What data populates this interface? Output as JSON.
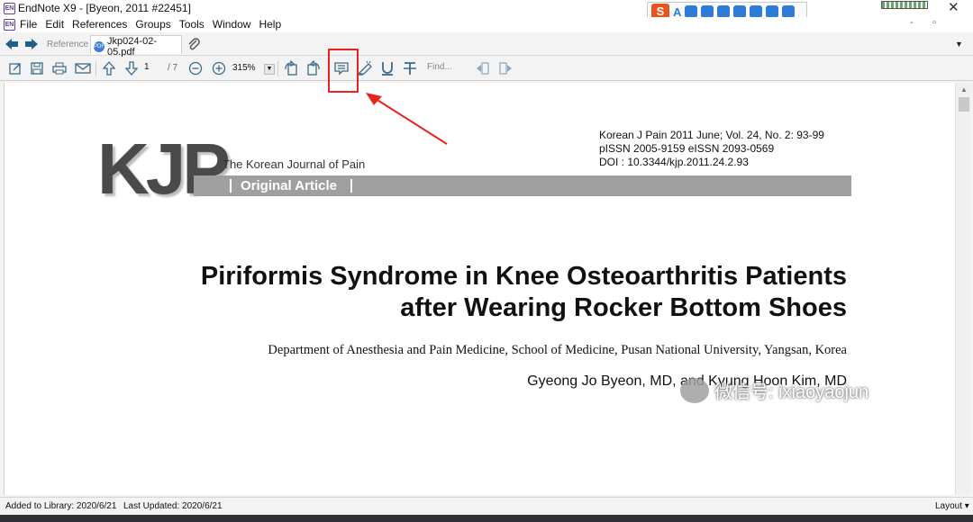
{
  "window": {
    "title": "EndNote X9 - [Byeon, 2011 #22451]",
    "app_icon": "EN",
    "close_glyph": "✕"
  },
  "ime": {
    "logo": "S",
    "label": "A"
  },
  "menu": {
    "items": [
      "File",
      "Edit",
      "References",
      "Groups",
      "Tools",
      "Window",
      "Help"
    ],
    "minimize": "-",
    "restore": "▫"
  },
  "tabs": {
    "reference": "Reference",
    "pdf": "Jkp024-02-05.pdf",
    "pdf_badge": "PDF",
    "dropdown": "▼"
  },
  "toolbar": {
    "page_current": "1",
    "page_total": "/ 7",
    "zoom": "315%",
    "zoom_dropdown": "▼",
    "find_placeholder": "Find..."
  },
  "document": {
    "journal_lines": [
      "Korean J Pain 2011 June; Vol. 24, No. 2: 93-99",
      "pISSN 2005-9159   eISSN 2093-0569",
      "DOI : 10.3344/kjp.2011.24.2.93"
    ],
    "logo_text": "KJP",
    "journal_name": "The Korean Journal of Pain",
    "article_type": "Original Article",
    "title_line1": "Piriformis Syndrome in Knee Osteoarthritis Patients",
    "title_line2": "after Wearing Rocker Bottom Shoes",
    "department": "Department of Anesthesia and Pain Medicine, School of Medicine, Pusan National University, Yangsan, Korea",
    "authors": "Gyeong Jo Byeon, MD, and Kyung Hoon Kim, MD"
  },
  "watermark": {
    "text": "微信号: ixiaoyaojun"
  },
  "status": {
    "added": "Added to Library: 2020/6/21",
    "updated": "Last Updated: 2020/6/21",
    "layout": "Layout ▾"
  },
  "colors": {
    "accent_red": "#e8231f",
    "icon_blue": "#3c6a8a",
    "band_gray": "#9f9f9f"
  }
}
